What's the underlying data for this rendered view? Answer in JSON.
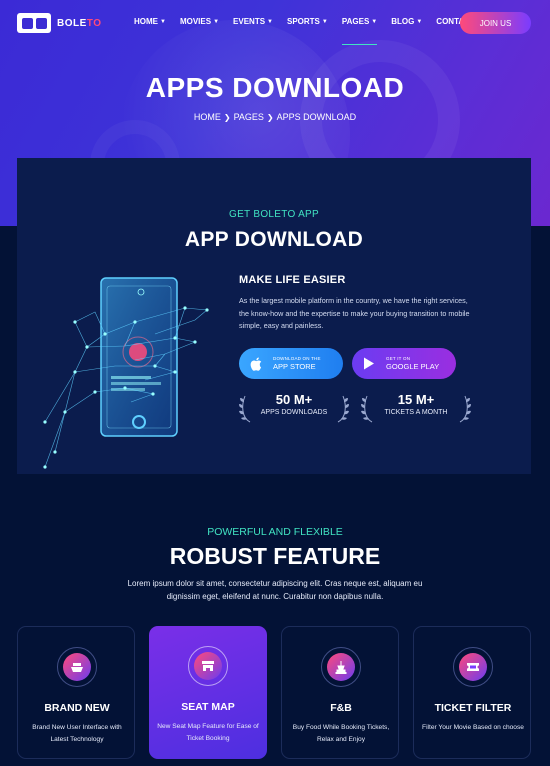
{
  "brand": {
    "name_main": "BOLE",
    "name_accent": "TO"
  },
  "nav": {
    "items": [
      {
        "label": "HOME",
        "dropdown": true
      },
      {
        "label": "MOVIES",
        "dropdown": true
      },
      {
        "label": "EVENTS",
        "dropdown": true
      },
      {
        "label": "SPORTS",
        "dropdown": true
      },
      {
        "label": "PAGES",
        "dropdown": true,
        "active": true
      },
      {
        "label": "BLOG",
        "dropdown": true
      },
      {
        "label": "CONTACT",
        "dropdown": false
      }
    ],
    "cta": "JOIN US"
  },
  "hero": {
    "title": "APPS DOWNLOAD",
    "breadcrumb": [
      "HOME",
      "PAGES",
      "APPS DOWNLOAD"
    ]
  },
  "app_section": {
    "eyebrow": "GET BOLETO APP",
    "title": "APP DOWNLOAD",
    "subtitle": "MAKE LIFE EASIER",
    "description": "As the largest mobile platform in the country, we have the right services, the know-how and the expertise to make your buying transition to mobile simple, easy and painless.",
    "stores": [
      {
        "small": "DOWNLOAD ON THE",
        "big": "APP STORE",
        "icon": "apple-icon"
      },
      {
        "small": "GET IT ON",
        "big": "GOOGLE PLAY",
        "icon": "play-icon"
      }
    ],
    "stats": [
      {
        "value": "50 M+",
        "label": "APPS DOWNLOADS"
      },
      {
        "value": "15 M+",
        "label": "TICKETS A MONTH"
      }
    ]
  },
  "features": {
    "eyebrow": "POWERFUL AND FLEXIBLE",
    "title": "ROBUST FEATURE",
    "description": "Lorem ipsum dolor sit amet, consectetur adipiscing elit. Cras neque est, aliquam eu dignissim eget, eleifend at nunc. Curabitur non dapibus nulla.",
    "items": [
      {
        "name": "BRAND NEW",
        "text": "Brand New User Interface with Latest Technology",
        "icon": "ship-icon"
      },
      {
        "name": "SEAT MAP",
        "text": "New Seat Map Feature for Ease of Ticket Booking",
        "icon": "seat-map-icon"
      },
      {
        "name": "F&B",
        "text": "Buy Food While Booking Tickets, Relax and Enjoy",
        "icon": "food-drink-icon"
      },
      {
        "name": "TICKET FILTER",
        "text": "Filter Your Movie Based on choose",
        "icon": "ticket-icon"
      }
    ]
  },
  "colors": {
    "accent_teal": "#41e3c2",
    "accent_pink": "#ff4a7a",
    "bg_dark": "#031236",
    "card_bg": "#0b1c4d"
  }
}
